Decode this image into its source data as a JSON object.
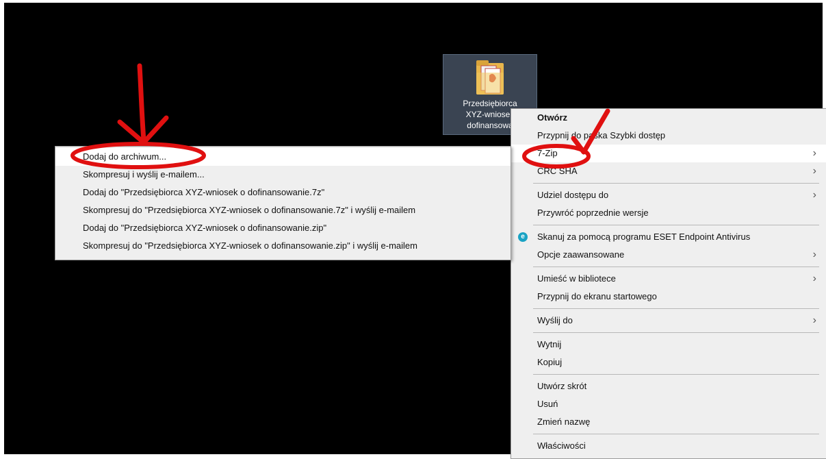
{
  "desktop": {
    "file": {
      "label": "Przedsiębiorca\nXYZ-wniosek\ndofinansowa",
      "icon": "pdf-folder-icon"
    }
  },
  "context_menu": {
    "items": [
      {
        "label": "Otwórz",
        "bold": true
      },
      {
        "label": "Przypnij do paska Szybki dostęp"
      },
      {
        "label": "7-Zip",
        "submenu": true,
        "highlighted": true
      },
      {
        "label": "CRC SHA",
        "submenu": true
      },
      {
        "label": "Udziel dostępu do",
        "submenu": true
      },
      {
        "label": "Przywróć poprzednie wersje"
      },
      {
        "label": "Skanuj za pomocą programu ESET Endpoint Antivirus",
        "icon": "eset-icon"
      },
      {
        "label": "Opcje zaawansowane",
        "submenu": true
      },
      {
        "label": "Umieść w bibliotece",
        "submenu": true
      },
      {
        "label": "Przypnij do ekranu startowego"
      },
      {
        "label": "Wyślij do",
        "submenu": true
      },
      {
        "label": "Wytnij"
      },
      {
        "label": "Kopiuj"
      },
      {
        "label": "Utwórz skrót"
      },
      {
        "label": "Usuń"
      },
      {
        "label": "Zmień nazwę"
      },
      {
        "label": "Właściwości"
      }
    ],
    "arrow_glyph": "›"
  },
  "zip_submenu": {
    "items": [
      {
        "label": "Dodaj do archiwum...",
        "highlighted": true
      },
      {
        "label": "Skompresuj i wyślij e-mailem..."
      },
      {
        "label": "Dodaj do \"Przedsiębiorca XYZ-wniosek o dofinansowanie.7z\""
      },
      {
        "label": "Skompresuj do \"Przedsiębiorca XYZ-wniosek o dofinansowanie.7z\" i wyślij e-mailem"
      },
      {
        "label": "Dodaj do \"Przedsiębiorca XYZ-wniosek o dofinansowanie.zip\""
      },
      {
        "label": "Skompresuj do \"Przedsiębiorca XYZ-wniosek o dofinansowanie.zip\" i wyślij e-mailem"
      }
    ]
  },
  "colors": {
    "annotation": "#e01010",
    "highlight": "#ffffff",
    "menu_bg": "#efefef"
  }
}
